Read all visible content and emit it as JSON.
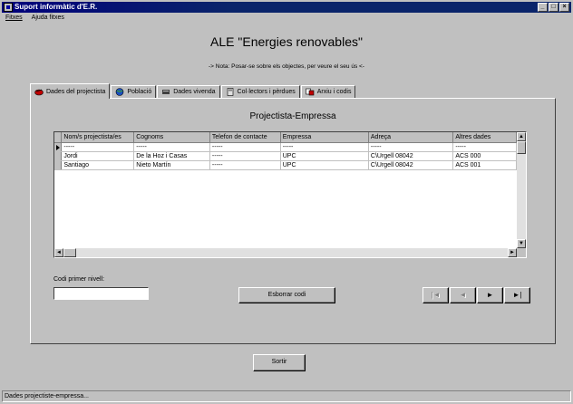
{
  "window": {
    "title": "Suport informàtic d'E.R.",
    "buttons": [
      "_",
      "□",
      "×"
    ]
  },
  "menu": {
    "items": [
      "Fitxes",
      "Ajuda fitxes"
    ]
  },
  "header": {
    "title": "ALE \"Energies renovables\"",
    "note": "-> Nota: Posar-se sobre els objectes, per veure el seu ús <-"
  },
  "tabs": [
    {
      "label": "Dades del projectista",
      "icon": "pencil-icon"
    },
    {
      "label": "Població",
      "icon": "globe-icon"
    },
    {
      "label": "Dades vivenda",
      "icon": "card-icon"
    },
    {
      "label": "Col·lectors i pèrdues",
      "icon": "calculator-icon"
    },
    {
      "label": "Arxiu i codis",
      "icon": "archive-icon"
    }
  ],
  "panel": {
    "title": "Projectista-Empressa"
  },
  "grid": {
    "columns": [
      "Nom/s projectista/es",
      "Cognoms",
      "Telefon de contacte",
      "Empressa",
      "Adreça",
      "Altres dades"
    ],
    "rows": [
      [
        "-----",
        "-----",
        "-----",
        "-----",
        "-----",
        "-----"
      ],
      [
        "Jordi",
        "De la Hoz i Casas",
        "-----",
        "UPC",
        "C\\Urgell 08042",
        "ACS 000"
      ],
      [
        "Santiago",
        "Nieto Martín",
        "-----",
        "UPC",
        "C\\Urgell 08042",
        "ACS 001"
      ]
    ],
    "current_row": 0
  },
  "code": {
    "label": "Codi primer nivell:",
    "value": ""
  },
  "buttons": {
    "erase": "Esborrar codi",
    "exit": "Sortir",
    "nav": [
      "|◄",
      "◄",
      "►",
      "►|"
    ]
  },
  "status": {
    "text": "Dades projectiste-empressa..."
  }
}
